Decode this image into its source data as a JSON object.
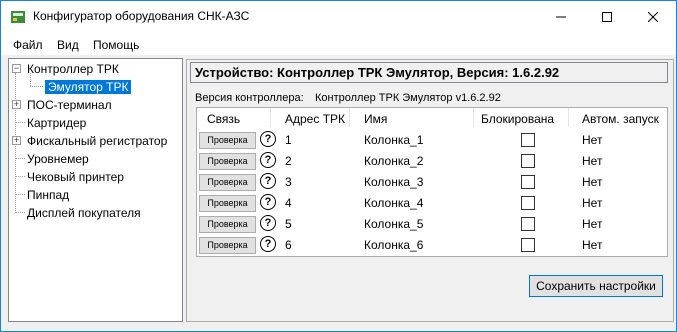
{
  "window": {
    "title": "Конфигуратор оборудования СНК-АЗС"
  },
  "menu": [
    "Файл",
    "Вид",
    "Помощь"
  ],
  "tree": {
    "items": [
      {
        "label": "Контроллер ТРК",
        "expander": "−"
      },
      {
        "label": "Эмулятор ТРК",
        "selected": true
      },
      {
        "label": "ПОС-терминал",
        "expander": "+"
      },
      {
        "label": "Картридер"
      },
      {
        "label": "Фискальный регистратор",
        "expander": "+"
      },
      {
        "label": "Уровнемер"
      },
      {
        "label": "Чековый принтер"
      },
      {
        "label": "Пинпад"
      },
      {
        "label": "Дисплей покупателя"
      }
    ]
  },
  "device": {
    "header": "Устройство: Контроллер ТРК Эмулятор, Версия: 1.6.2.92",
    "version_label": "Версия контроллера:",
    "version_value": "Контроллер ТРК Эмулятор v1.6.2.92"
  },
  "table": {
    "columns": [
      "Связь",
      "Адрес ТРК",
      "Имя",
      "Блокирована",
      "Автом. запуск"
    ],
    "check_label": "Проверка",
    "help_glyph": "?",
    "rows": [
      {
        "address": "1",
        "name": "Колонка_1",
        "blocked": false,
        "autostart": "Нет"
      },
      {
        "address": "2",
        "name": "Колонка_2",
        "blocked": false,
        "autostart": "Нет"
      },
      {
        "address": "3",
        "name": "Колонка_3",
        "blocked": false,
        "autostart": "Нет"
      },
      {
        "address": "4",
        "name": "Колонка_4",
        "blocked": false,
        "autostart": "Нет"
      },
      {
        "address": "5",
        "name": "Колонка_5",
        "blocked": false,
        "autostart": "Нет"
      },
      {
        "address": "6",
        "name": "Колонка_6",
        "blocked": false,
        "autostart": "Нет"
      }
    ]
  },
  "buttons": {
    "save": "Сохранить настройки"
  },
  "colors": {
    "accent": "#0078d7",
    "border": "#1883d7"
  }
}
